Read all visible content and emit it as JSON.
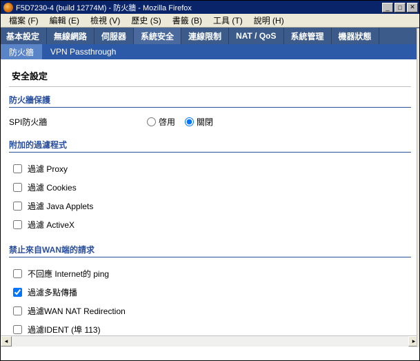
{
  "window": {
    "title": "F5D7230-4 (build 12774M) - 防火牆 - Mozilla Firefox"
  },
  "menubar": {
    "items": [
      {
        "label": "檔案 (F)"
      },
      {
        "label": "編輯 (E)"
      },
      {
        "label": "檢視 (V)"
      },
      {
        "label": "歷史 (S)"
      },
      {
        "label": "書籤 (B)"
      },
      {
        "label": "工具 (T)"
      },
      {
        "label": "說明 (H)"
      }
    ]
  },
  "primary_tabs": {
    "items": [
      {
        "label": "基本設定"
      },
      {
        "label": "無線網路"
      },
      {
        "label": "伺服器"
      },
      {
        "label": "系統安全"
      },
      {
        "label": "連線限制"
      },
      {
        "label": "NAT / QoS"
      },
      {
        "label": "系統管理"
      },
      {
        "label": "機器狀態"
      }
    ],
    "active_index": 3
  },
  "secondary_tabs": {
    "items": [
      {
        "label": "防火牆"
      },
      {
        "label": "VPN Passthrough"
      }
    ],
    "active_index": 0
  },
  "page": {
    "heading": "安全設定",
    "section_firewall": {
      "title": "防火牆保護",
      "spi_label": "SPI防火牆",
      "enable_label": "啓用",
      "disable_label": "關閉",
      "selected": "disable"
    },
    "section_filters": {
      "title": "附加的過濾程式",
      "items": [
        {
          "label": "過濾 Proxy",
          "checked": false
        },
        {
          "label": "過濾 Cookies",
          "checked": false
        },
        {
          "label": "過濾 Java Applets",
          "checked": false
        },
        {
          "label": "過濾 ActiveX",
          "checked": false
        }
      ]
    },
    "section_wan": {
      "title": "禁止來自WAN端的請求",
      "items": [
        {
          "label": "不回應 Internet的 ping",
          "checked": false
        },
        {
          "label": "過濾多點傳播",
          "checked": true
        },
        {
          "label": "過濾WAN NAT Redirection",
          "checked": false
        },
        {
          "label": "過濾IDENT (埠 113)",
          "checked": false
        }
      ]
    }
  }
}
